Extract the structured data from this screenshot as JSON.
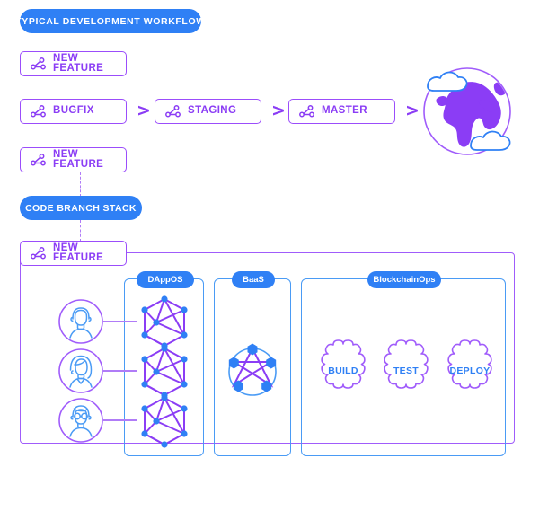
{
  "header": {
    "title_badge": "TYPICAL DEVELOPMENT WORKFLOW"
  },
  "workflow": {
    "branches": [
      {
        "label": "NEW FEATURE",
        "icon": "git-branch-icon"
      },
      {
        "label": "BUGFIX",
        "icon": "git-branch-icon"
      },
      {
        "label": "STAGING",
        "icon": "git-branch-icon"
      },
      {
        "label": "MASTER",
        "icon": "git-branch-icon"
      },
      {
        "label": "NEW FEATURE",
        "icon": "git-branch-icon"
      }
    ],
    "arrows": [
      ">",
      ">"
    ],
    "globe": {
      "icon": "globe-with-clouds-icon",
      "globe_color": "#8b3df5",
      "cloud_outline_color": "#2f80f5"
    }
  },
  "stack": {
    "badge": "CODE BRANCH STACK",
    "branch": {
      "label": "NEW FEATURE",
      "icon": "git-branch-icon"
    }
  },
  "platform": {
    "sections": [
      {
        "label": "DAppOS",
        "icon": "mesh-network-icon"
      },
      {
        "label": "BaaS",
        "icon": "pentagon-network-icon"
      },
      {
        "label": "BlockchainOps",
        "icon": "gear-pipeline-icon"
      }
    ],
    "users": [
      {
        "icon": "user-avatar-icon",
        "alt": "user-1"
      },
      {
        "icon": "user-avatar-icon",
        "alt": "user-2"
      },
      {
        "icon": "user-avatar-icon",
        "alt": "user-3"
      }
    ],
    "pipeline_stages": [
      {
        "label": "BUILD",
        "icon": "gear-icon"
      },
      {
        "label": "TEST",
        "icon": "gear-icon"
      },
      {
        "label": "DEPLOY",
        "icon": "gear-icon"
      }
    ]
  },
  "theme": {
    "blue": "#2f80f5",
    "blue_line": "#4a9bf5",
    "purple": "#8b3df5",
    "purple_line": "#a05cfb",
    "purple_soft": "#b07cf7",
    "background": "#ffffff"
  }
}
